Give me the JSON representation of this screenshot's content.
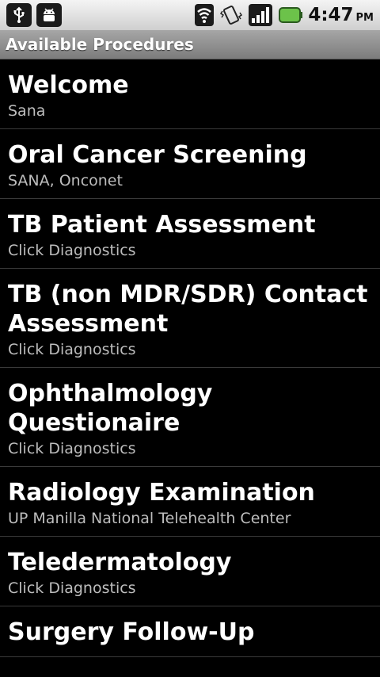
{
  "status_bar": {
    "icons_left": [
      "usb-icon",
      "android-debug-icon"
    ],
    "icons_right": [
      "wifi-icon",
      "vibrate-icon",
      "signal-icon",
      "battery-icon"
    ],
    "time": "4:47",
    "ampm": "PM"
  },
  "title_bar": {
    "title": "Available Procedures"
  },
  "procedures": [
    {
      "title": "Welcome",
      "subtitle": "Sana"
    },
    {
      "title": "Oral Cancer Screening",
      "subtitle": "SANA, Onconet"
    },
    {
      "title": "TB Patient Assessment",
      "subtitle": "Click Diagnostics"
    },
    {
      "title": "TB (non MDR/SDR) Contact Assessment",
      "subtitle": "Click Diagnostics"
    },
    {
      "title": "Ophthalmology Questionaire",
      "subtitle": "Click Diagnostics"
    },
    {
      "title": "Radiology Examination",
      "subtitle": "UP Manilla National Telehealth Center"
    },
    {
      "title": "Teledermatology",
      "subtitle": "Click Diagnostics"
    },
    {
      "title": "Surgery Follow-Up",
      "subtitle": ""
    }
  ],
  "colors": {
    "background": "#000000",
    "title_text": "#ffffff",
    "subtitle_text": "#bdbdbd",
    "battery": "#6cc24a"
  }
}
